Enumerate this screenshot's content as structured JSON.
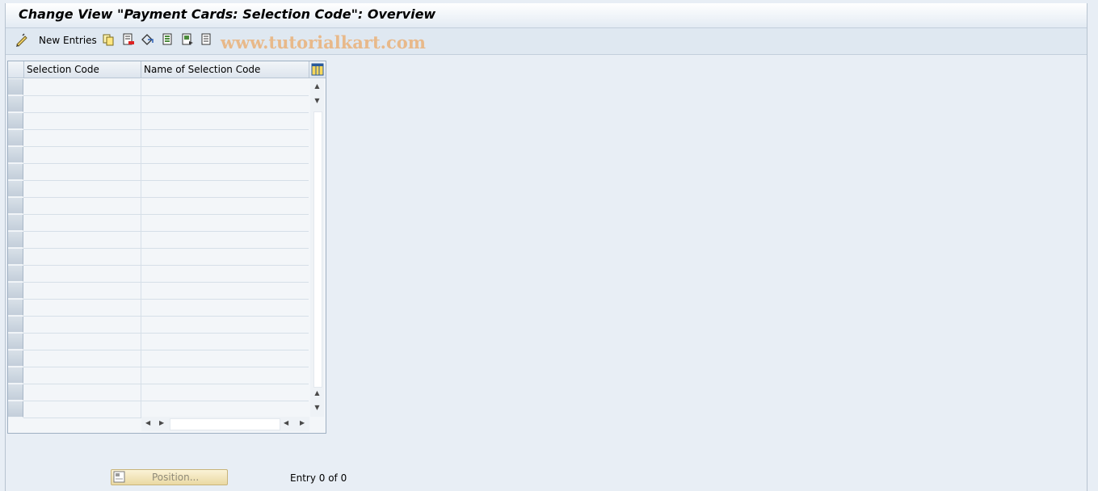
{
  "window": {
    "title": "Change View \"Payment Cards: Selection Code\": Overview"
  },
  "toolbar": {
    "new_entries_label": "New Entries",
    "icons": [
      "edit-pen-icon",
      "copy-icon",
      "delete-icon",
      "undo-change-icon",
      "select-all-icon",
      "select-block-icon",
      "deselect-all-icon"
    ],
    "watermark": "www.tutorialkart.com"
  },
  "table": {
    "columns": [
      "Selection Code",
      "Name of Selection Code"
    ],
    "row_count": 20,
    "rows": []
  },
  "footer": {
    "position_label": "Position...",
    "entry_info": "Entry 0 of 0"
  },
  "colors": {
    "background": "#e8eef5",
    "watermark": "#e8b98a",
    "position_button": "#f4e7bd"
  }
}
